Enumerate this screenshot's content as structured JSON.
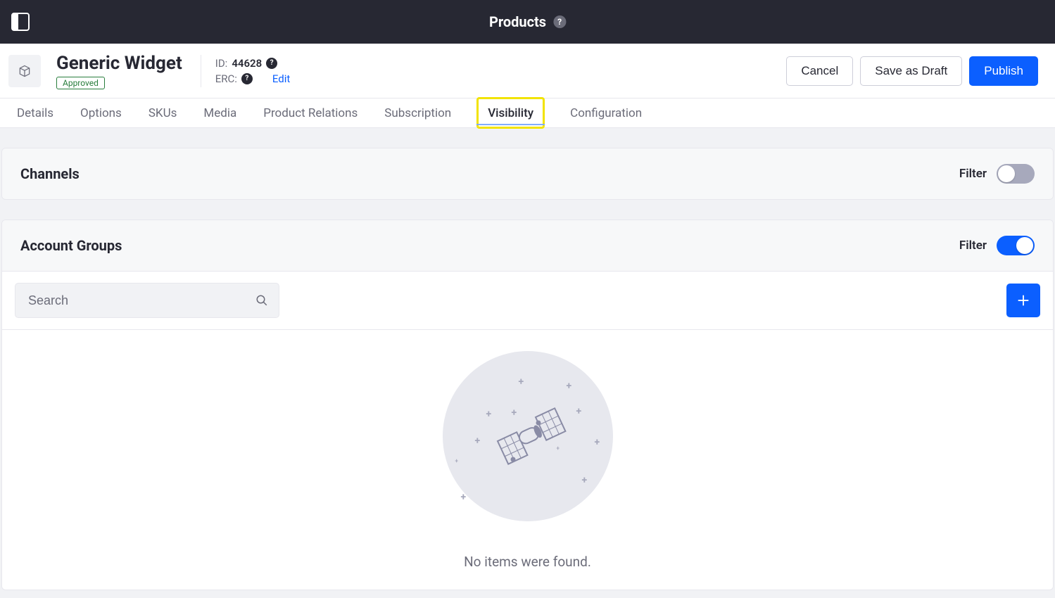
{
  "topbar": {
    "title": "Products"
  },
  "header": {
    "product_name": "Generic Widget",
    "status": "Approved",
    "id_label": "ID:",
    "id_value": "44628",
    "erc_label": "ERC:",
    "edit_label": "Edit",
    "actions": {
      "cancel": "Cancel",
      "save_draft": "Save as Draft",
      "publish": "Publish"
    }
  },
  "tabs": [
    {
      "label": "Details",
      "active": false
    },
    {
      "label": "Options",
      "active": false
    },
    {
      "label": "SKUs",
      "active": false
    },
    {
      "label": "Media",
      "active": false
    },
    {
      "label": "Product Relations",
      "active": false
    },
    {
      "label": "Subscription",
      "active": false
    },
    {
      "label": "Visibility",
      "active": true
    },
    {
      "label": "Configuration",
      "active": false
    }
  ],
  "panels": {
    "channels": {
      "title": "Channels",
      "filter_label": "Filter",
      "filter_on": false
    },
    "account_groups": {
      "title": "Account Groups",
      "filter_label": "Filter",
      "filter_on": true,
      "search_placeholder": "Search",
      "empty_message": "No items were found."
    }
  }
}
